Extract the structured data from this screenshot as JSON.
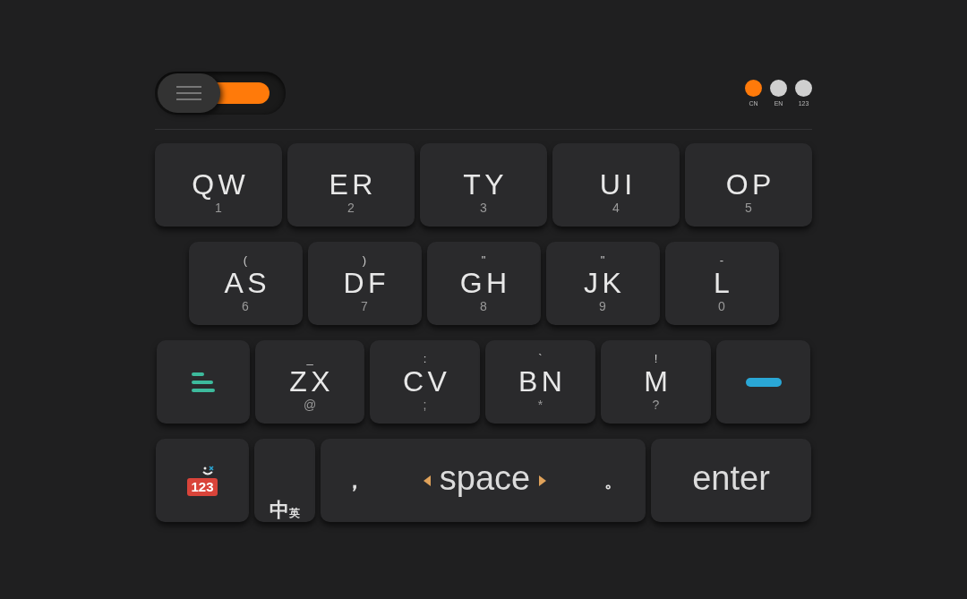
{
  "mode_switch": {
    "on": true
  },
  "languages": [
    {
      "label": "CN",
      "selected": true
    },
    {
      "label": "EN",
      "selected": false
    },
    {
      "label": "123",
      "selected": false
    }
  ],
  "rows": [
    {
      "keys": [
        {
          "kind": "letter",
          "letters": "QW",
          "number": "1"
        },
        {
          "kind": "letter",
          "letters": "ER",
          "number": "2"
        },
        {
          "kind": "letter",
          "letters": "TY",
          "number": "3"
        },
        {
          "kind": "letter",
          "letters": "UI",
          "number": "4"
        },
        {
          "kind": "letter",
          "letters": "OP",
          "number": "5"
        }
      ]
    },
    {
      "keys": [
        {
          "kind": "letter",
          "symbol": "(",
          "letters": "AS",
          "number": "6"
        },
        {
          "kind": "letter",
          "symbol": ")",
          "letters": "DF",
          "number": "7"
        },
        {
          "kind": "letter",
          "symbol": "\"",
          "letters": "GH",
          "number": "8"
        },
        {
          "kind": "letter",
          "symbol": "\"",
          "letters": "JK",
          "number": "9"
        },
        {
          "kind": "letter",
          "symbol": "-",
          "letters": "L",
          "number": "0"
        }
      ]
    },
    {
      "keys": [
        {
          "kind": "menu"
        },
        {
          "kind": "letter",
          "symbol": "_",
          "letters": "ZX",
          "number": "@"
        },
        {
          "kind": "letter",
          "symbol": ":",
          "letters": "CV",
          "number": ";"
        },
        {
          "kind": "letter",
          "symbol": "`",
          "letters": "BN",
          "number": "*"
        },
        {
          "kind": "letter",
          "symbol": "!",
          "letters": "M",
          "number": "?"
        },
        {
          "kind": "dash"
        }
      ]
    },
    {
      "keys": [
        {
          "kind": "numbers",
          "label": "123"
        },
        {
          "kind": "language",
          "main": "中",
          "sub": "英"
        },
        {
          "kind": "space",
          "left": "，",
          "label": "space",
          "right": "。"
        },
        {
          "kind": "enter",
          "label": "enter"
        }
      ]
    }
  ]
}
